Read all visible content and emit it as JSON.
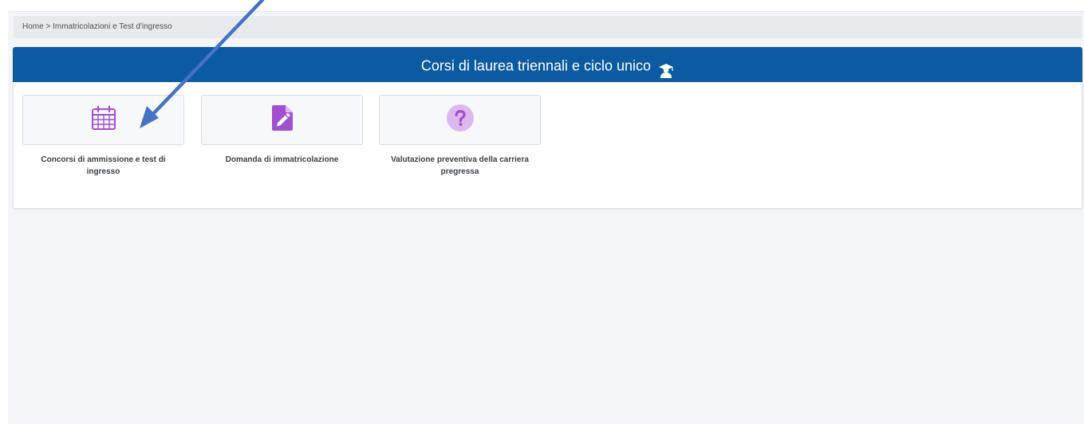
{
  "breadcrumb": {
    "home": "Home",
    "separator": ">",
    "current": "Immatricolazioni e Test d'ingresso"
  },
  "panel": {
    "title": "Corsi di laurea triennali e ciclo unico",
    "title_icon": "graduation-cap-icon"
  },
  "cards": [
    {
      "icon": "calendar-icon",
      "label": "Concorsi di ammissione e test di ingresso"
    },
    {
      "icon": "file-edit-icon",
      "label": "Domanda di immatricolazione"
    },
    {
      "icon": "question-circle-icon",
      "label": "Valutazione preventiva della carriera pregressa"
    }
  ],
  "colors": {
    "header_blue": "#0b5aa2",
    "icon_purple": "#a24fd0",
    "icon_purple_light": "#dcb8ef",
    "annotation_arrow": "#4472c4"
  }
}
